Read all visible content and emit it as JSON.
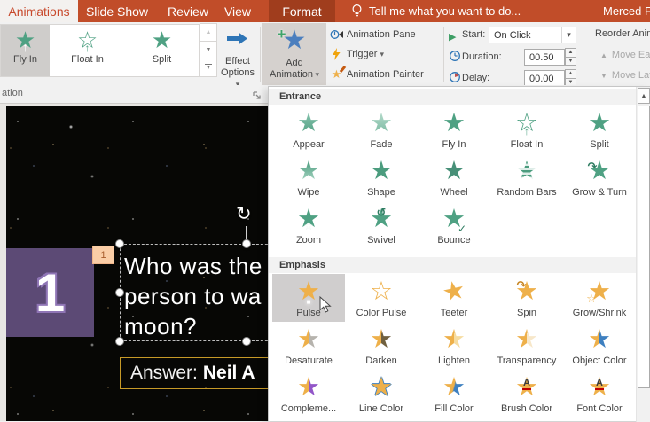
{
  "colors": {
    "ribbon_orange": "#c14d29",
    "format_tab_dark": "#a03d1d",
    "entrance_star_green": "#4fa183",
    "emphasis_star_gold": "#eeb04a",
    "slide_number_purple": "#5c4a75",
    "answer_border_gold": "#c79a27",
    "selection_highlight_gray": "#d0cece"
  },
  "tab_bar": {
    "active_tab": "Animations",
    "tabs": [
      "Slide Show",
      "Review",
      "View"
    ],
    "contextual_tab": "Format",
    "tell_me": "Tell me what you want to do...",
    "account_name": "Merced Fl"
  },
  "ribbon": {
    "group_label": "ation",
    "gallery": {
      "items": [
        {
          "label": "Fly In",
          "icon": "fly-in",
          "selected": true
        },
        {
          "label": "Float In",
          "icon": "float-in",
          "selected": false
        },
        {
          "label": "Split",
          "icon": "split",
          "selected": false
        }
      ]
    },
    "effect_options": {
      "line1": "Effect",
      "line2": "Options"
    },
    "add_animation": {
      "line1": "Add",
      "line2": "Animation"
    },
    "advanced": {
      "animation_pane": "Animation Pane",
      "trigger": "Trigger",
      "animation_painter": "Animation Painter"
    },
    "timing": {
      "start_label": "Start:",
      "start_value": "On Click",
      "duration_label": "Duration:",
      "duration_value": "00.50",
      "delay_label": "Delay:",
      "delay_value": "00.00"
    },
    "reorder": {
      "title": "Reorder Anim",
      "move_earlier": "Move Ear",
      "move_later": "Move Lat"
    }
  },
  "menu": {
    "sections": [
      {
        "title": "Entrance",
        "items": [
          {
            "label": "Appear",
            "icon": "appear"
          },
          {
            "label": "Fade",
            "icon": "fade"
          },
          {
            "label": "Fly In",
            "icon": "fly-in"
          },
          {
            "label": "Float In",
            "icon": "float-in"
          },
          {
            "label": "Split",
            "icon": "split"
          },
          {
            "label": "Wipe",
            "icon": "wipe"
          },
          {
            "label": "Shape",
            "icon": "shape"
          },
          {
            "label": "Wheel",
            "icon": "wheel"
          },
          {
            "label": "Random Bars",
            "icon": "random-bars"
          },
          {
            "label": "Grow & Turn",
            "icon": "grow-turn"
          },
          {
            "label": "Zoom",
            "icon": "zoom"
          },
          {
            "label": "Swivel",
            "icon": "swivel"
          },
          {
            "label": "Bounce",
            "icon": "bounce"
          }
        ]
      },
      {
        "title": "Emphasis",
        "items": [
          {
            "label": "Pulse",
            "icon": "pulse",
            "selected": true
          },
          {
            "label": "Color Pulse",
            "icon": "color-pulse"
          },
          {
            "label": "Teeter",
            "icon": "teeter"
          },
          {
            "label": "Spin",
            "icon": "spin"
          },
          {
            "label": "Grow/Shrink",
            "icon": "grow-shrink"
          },
          {
            "label": "Desaturate",
            "icon": "desaturate"
          },
          {
            "label": "Darken",
            "icon": "darken"
          },
          {
            "label": "Lighten",
            "icon": "lighten"
          },
          {
            "label": "Transparency",
            "icon": "transparency"
          },
          {
            "label": "Object Color",
            "icon": "object-color"
          },
          {
            "label": "Compleme...",
            "icon": "complementary"
          },
          {
            "label": "Line Color",
            "icon": "line-color"
          },
          {
            "label": "Fill Color",
            "icon": "fill-color"
          },
          {
            "label": "Brush Color",
            "icon": "brush-color"
          },
          {
            "label": "Font Color",
            "icon": "font-color"
          }
        ]
      }
    ]
  },
  "slide": {
    "number_shape": "1",
    "animation_badge": "1",
    "question_lines": [
      "Who was the",
      "person to wa",
      "moon?"
    ],
    "answer_prefix": "Answer:",
    "answer_bold": "Neil A"
  }
}
